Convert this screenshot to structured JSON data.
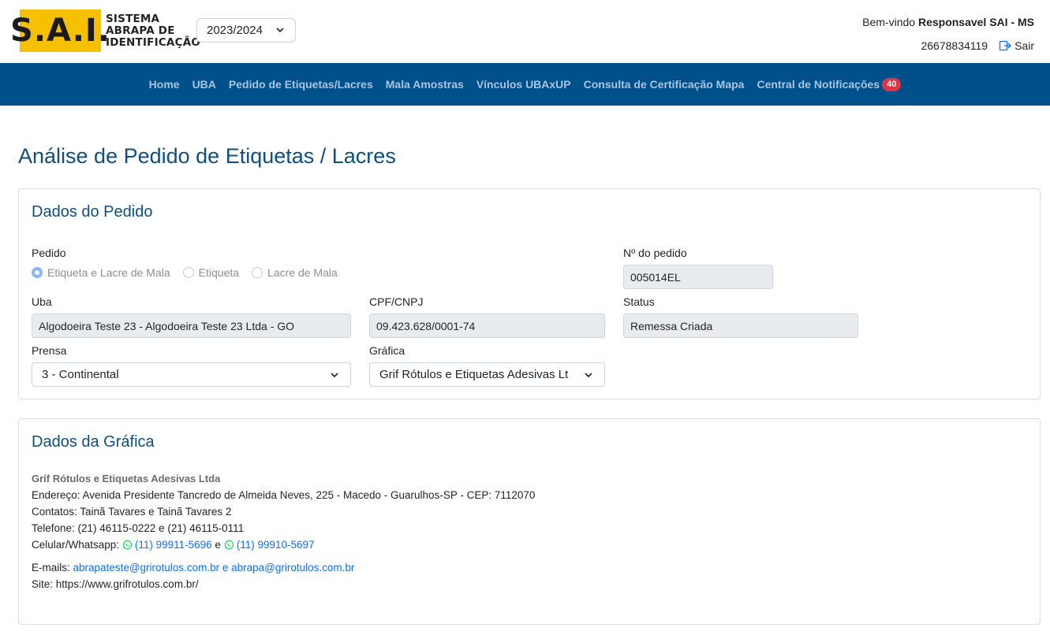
{
  "header": {
    "logo_letters": "S.A.I.",
    "logo_line1": "SISTEMA",
    "logo_line2": "ABRAPA DE",
    "logo_line3": "IDENTIFICAÇÃO",
    "year": "2023/2024",
    "welcome_prefix": "Bem-vindo",
    "welcome_user": "Responsavel SAI - MS",
    "user_id": "26678834119",
    "logout_label": "Sair"
  },
  "nav": {
    "items": [
      "Home",
      "UBA",
      "Pedido de Etiquetas/Lacres",
      "Mala Amostras",
      "Vínculos UBAxUP",
      "Consulta de Certificação Mapa",
      "Central de Notificações"
    ],
    "notifications_count": "40"
  },
  "page": {
    "title": "Análise de Pedido de Etiquetas / Lacres"
  },
  "pedido": {
    "section_title": "Dados do Pedido",
    "pedido_label": "Pedido",
    "radio_options": [
      "Etiqueta e Lacre de Mala",
      "Etiqueta",
      "Lacre de Mala"
    ],
    "numero_label": "Nº do pedido",
    "numero_value": "005014EL",
    "uba_label": "Uba",
    "uba_value": "Algodoeira Teste 23 - Algodoeira Teste 23 Ltda - GO",
    "cpf_label": "CPF/CNPJ",
    "cpf_value": "09.423.628/0001-74",
    "status_label": "Status",
    "status_value": "Remessa Criada",
    "prensa_label": "Prensa",
    "prensa_value": "3 - Continental",
    "grafica_label": "Gráfica",
    "grafica_value": "Grif Rótulos e Etiquetas Adesivas Lt"
  },
  "grafica": {
    "section_title": "Dados da Gráfica",
    "name": "Grif Rótulos e Etiquetas Adesivas Ltda",
    "endereco": "Endereço: Avenida Presidente Tancredo de Almeida Neves, 225 - Macedo - Guarulhos-SP - CEP: 7112070",
    "contatos": "Contatos: Tainã Tavares e Tainã Tavares 2",
    "telefone": "Telefone: (21) 46115-0222 e (21) 46115-0111",
    "celular_label": "Celular/Whatsapp:",
    "celular1": "(11) 99911-5696",
    "celular_sep": "e",
    "celular2": "(11) 99910-5697",
    "emails_label": "E-mails:",
    "email1": "abrapateste@grirotulos.com.br",
    "email_sep": "e",
    "email2": "abrapa@grirotulos.com.br",
    "site": "Site: https://www.grifrotulos.com.br/"
  },
  "colors": {
    "nav_bg": "#00508c",
    "title": "#0e4f80",
    "logo_yellow": "#f5c000",
    "badge": "#dc3545",
    "whatsapp": "#25d366"
  }
}
